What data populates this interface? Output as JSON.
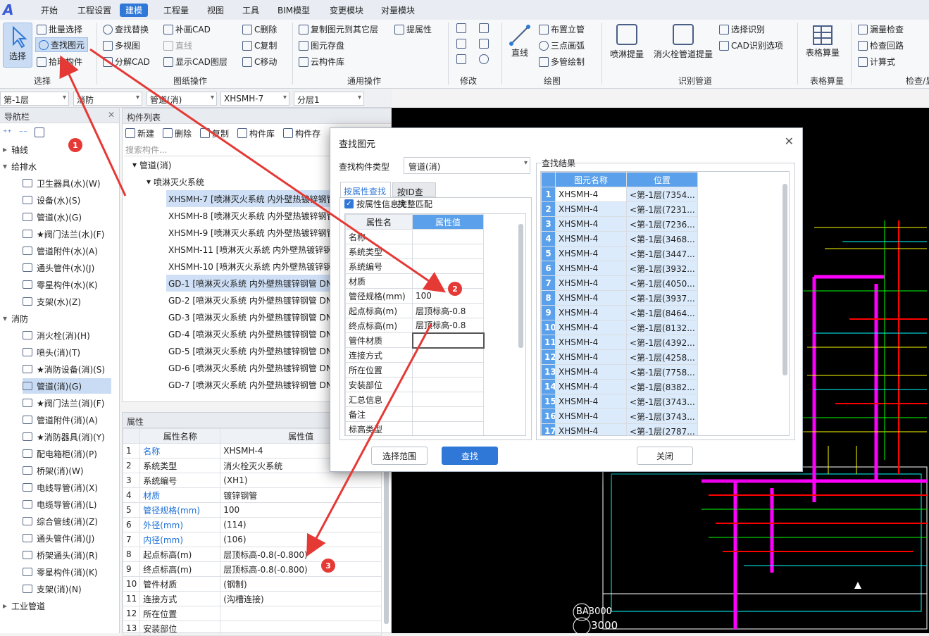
{
  "menubar": {
    "items": [
      "开始",
      "工程设置",
      "建模",
      "工程量",
      "视图",
      "工具",
      "BIM模型",
      "变更模块",
      "对量模块"
    ],
    "active_index": 2
  },
  "ribbon": {
    "select_big": "选择",
    "select_group": [
      "批量选择",
      "查找图元",
      "拾取构件"
    ],
    "group_select": "选择",
    "drawing_ops": [
      "查找替换",
      "补画CAD",
      "C删除",
      "多视图",
      "直线",
      "C复制",
      "分解CAD",
      "显示CAD图层",
      "C移动"
    ],
    "group_drawing": "图纸操作",
    "general_ops": [
      "复制图元到其它层",
      "提属性",
      "图元存盘",
      "云构件库"
    ],
    "group_general": "通用操作",
    "group_modify": "修改",
    "draw_line": "直线",
    "draw_ops": [
      "布置立管",
      "三点画弧",
      "多管绘制"
    ],
    "group_draw": "绘图",
    "identify_big": [
      "喷淋提量",
      "消火栓管道提量"
    ],
    "identify_ops": [
      "选择识别",
      "CAD识别选项"
    ],
    "group_identify": "识别管道",
    "table_big": "表格算量",
    "group_table": "表格算量",
    "check_ops": [
      "漏量检查",
      "检查回路",
      "计算式"
    ],
    "group_check": "检查/显"
  },
  "selectors": [
    "第-1层",
    "消防",
    "管道(消)",
    "XHSMH-7",
    "分层1"
  ],
  "nav": {
    "title": "导航栏",
    "items": [
      {
        "label": "轴线",
        "level": 0,
        "expand": "▸"
      },
      {
        "label": "给排水",
        "level": 0,
        "expand": "▾"
      },
      {
        "label": "卫生器具(水)(W)",
        "level": 1
      },
      {
        "label": "设备(水)(S)",
        "level": 1
      },
      {
        "label": "管道(水)(G)",
        "level": 1
      },
      {
        "label": "★阀门法兰(水)(F)",
        "level": 1
      },
      {
        "label": "管道附件(水)(A)",
        "level": 1
      },
      {
        "label": "通头管件(水)(J)",
        "level": 1
      },
      {
        "label": "零星构件(水)(K)",
        "level": 1
      },
      {
        "label": "支架(水)(Z)",
        "level": 1
      },
      {
        "label": "消防",
        "level": 0,
        "expand": "▾"
      },
      {
        "label": "消火栓(消)(H)",
        "level": 1
      },
      {
        "label": "喷头(消)(T)",
        "level": 1
      },
      {
        "label": "★消防设备(消)(S)",
        "level": 1
      },
      {
        "label": "管道(消)(G)",
        "level": 1,
        "selected": true
      },
      {
        "label": "★阀门法兰(消)(F)",
        "level": 1
      },
      {
        "label": "管道附件(消)(A)",
        "level": 1
      },
      {
        "label": "★消防器具(消)(Y)",
        "level": 1
      },
      {
        "label": "配电箱柜(消)(P)",
        "level": 1
      },
      {
        "label": "桥架(消)(W)",
        "level": 1
      },
      {
        "label": "电线导管(消)(X)",
        "level": 1
      },
      {
        "label": "电缆导管(消)(L)",
        "level": 1
      },
      {
        "label": "综合管线(消)(Z)",
        "level": 1
      },
      {
        "label": "通头管件(消)(J)",
        "level": 1
      },
      {
        "label": "桥架通头(消)(R)",
        "level": 1
      },
      {
        "label": "零星构件(消)(K)",
        "level": 1
      },
      {
        "label": "支架(消)(N)",
        "level": 1
      },
      {
        "label": "工业管道",
        "level": 0,
        "expand": "▸"
      }
    ]
  },
  "complist": {
    "title": "构件列表",
    "toolbar": [
      "新建",
      "删除",
      "复制",
      "构件库",
      "构件存"
    ],
    "search_placeholder": "搜索构件...",
    "tree_root": "管道(消)",
    "tree_sub": "喷淋灭火系统",
    "rows": [
      {
        "name": "XHSMH-7 [喷淋灭火系统 内外壁热镀锌钢管",
        "selected": true
      },
      {
        "name": "XHSMH-8 [喷淋灭火系统 内外壁热镀锌钢管"
      },
      {
        "name": "XHSMH-9 [喷淋灭火系统 内外壁热镀锌钢管"
      },
      {
        "name": "XHSMH-11 [喷淋灭火系统 内外壁热镀锌钢"
      },
      {
        "name": "XHSMH-10 [喷淋灭火系统 内外壁热镀锌钢"
      },
      {
        "name": "GD-1 [喷淋灭火系统 内外壁热镀锌钢管 DN",
        "selected": true
      },
      {
        "name": "GD-2 [喷淋灭火系统 内外壁热镀锌钢管 DN"
      },
      {
        "name": "GD-3 [喷淋灭火系统 内外壁热镀锌钢管 DN"
      },
      {
        "name": "GD-4 [喷淋灭火系统 内外壁热镀锌钢管 DN"
      },
      {
        "name": "GD-5 [喷淋灭火系统 内外壁热镀锌钢管 DN"
      },
      {
        "name": "GD-6 [喷淋灭火系统 内外壁热镀锌钢管 DN"
      },
      {
        "name": "GD-7 [喷淋灭火系统 内外壁热镀锌钢管 DN"
      }
    ]
  },
  "props": {
    "title": "属性",
    "header": [
      "属性名称",
      "属性值"
    ],
    "rows": [
      {
        "n": "1",
        "name": "名称",
        "value": "XHSMH-4",
        "blue": true
      },
      {
        "n": "2",
        "name": "系统类型",
        "value": "消火栓灭火系统"
      },
      {
        "n": "3",
        "name": "系统编号",
        "value": "(XH1)"
      },
      {
        "n": "4",
        "name": "材质",
        "value": "镀锌钢管",
        "blue": true
      },
      {
        "n": "5",
        "name": "管径规格(mm)",
        "value": "100",
        "blue": true
      },
      {
        "n": "6",
        "name": "外径(mm)",
        "value": "(114)",
        "blue": true
      },
      {
        "n": "7",
        "name": "内径(mm)",
        "value": "(106)",
        "blue": true
      },
      {
        "n": "8",
        "name": "起点标高(m)",
        "value": "层顶标高-0.8(-0.800)"
      },
      {
        "n": "9",
        "name": "终点标高(m)",
        "value": "层顶标高-0.8(-0.800)"
      },
      {
        "n": "10",
        "name": "管件材质",
        "value": "(钢制)"
      },
      {
        "n": "11",
        "name": "连接方式",
        "value": "(沟槽连接)"
      },
      {
        "n": "12",
        "name": "所在位置",
        "value": ""
      },
      {
        "n": "13",
        "name": "安装部位",
        "value": ""
      }
    ]
  },
  "dialog": {
    "title": "查找图元",
    "type_label": "查找构件类型",
    "type_value": "管道(消)",
    "tab_attr": "按属性查找",
    "tab_id": "按ID查找",
    "full_match": "按属性信息完整匹配",
    "attr_header": [
      "属性名",
      "属性值"
    ],
    "attr_rows": [
      {
        "name": "名称",
        "value": ""
      },
      {
        "name": "系统类型",
        "value": ""
      },
      {
        "name": "系统编号",
        "value": ""
      },
      {
        "name": "材质",
        "value": ""
      },
      {
        "name": "管径规格(mm)",
        "value": "100"
      },
      {
        "name": "起点标高(m)",
        "value": "层顶标高-0.8"
      },
      {
        "name": "终点标高(m)",
        "value": "层顶标高-0.8"
      },
      {
        "name": "管件材质",
        "value": ""
      },
      {
        "name": "连接方式",
        "value": ""
      },
      {
        "name": "所在位置",
        "value": ""
      },
      {
        "name": "安装部位",
        "value": ""
      },
      {
        "name": "汇总信息",
        "value": ""
      },
      {
        "name": "备注",
        "value": ""
      },
      {
        "name": "标高类型",
        "value": ""
      }
    ],
    "results_label": "查找结果",
    "results_header": [
      "图元名称",
      "位置"
    ],
    "results": [
      {
        "n": "1",
        "name": "XHSMH-4",
        "pos": "<第-1层(7354..."
      },
      {
        "n": "2",
        "name": "XHSMH-4",
        "pos": "<第-1层(7231..."
      },
      {
        "n": "3",
        "name": "XHSMH-4",
        "pos": "<第-1层(7236..."
      },
      {
        "n": "4",
        "name": "XHSMH-4",
        "pos": "<第-1层(3468..."
      },
      {
        "n": "5",
        "name": "XHSMH-4",
        "pos": "<第-1层(3447..."
      },
      {
        "n": "6",
        "name": "XHSMH-4",
        "pos": "<第-1层(3932..."
      },
      {
        "n": "7",
        "name": "XHSMH-4",
        "pos": "<第-1层(4050..."
      },
      {
        "n": "8",
        "name": "XHSMH-4",
        "pos": "<第-1层(3937..."
      },
      {
        "n": "9",
        "name": "XHSMH-4",
        "pos": "<第-1层(8464..."
      },
      {
        "n": "10",
        "name": "XHSMH-4",
        "pos": "<第-1层(8132..."
      },
      {
        "n": "11",
        "name": "XHSMH-4",
        "pos": "<第-1层(4392..."
      },
      {
        "n": "12",
        "name": "XHSMH-4",
        "pos": "<第-1层(4258..."
      },
      {
        "n": "13",
        "name": "XHSMH-4",
        "pos": "<第-1层(7758..."
      },
      {
        "n": "14",
        "name": "XHSMH-4",
        "pos": "<第-1层(8382..."
      },
      {
        "n": "15",
        "name": "XHSMH-4",
        "pos": "<第-1层(3743..."
      },
      {
        "n": "16",
        "name": "XHSMH-4",
        "pos": "<第-1层(3743..."
      },
      {
        "n": "17",
        "name": "XHSMH-4",
        "pos": "<第-1层(2787..."
      }
    ],
    "btn_range": "选择范围",
    "btn_find": "查找",
    "btn_close": "关闭"
  },
  "annotations": [
    "1",
    "2",
    "3"
  ],
  "cad": {
    "axis_text": "BA3000",
    "dim_text": "3000"
  },
  "colors": {
    "accent": "#2f78d8",
    "arrow": "#e53935",
    "cad_bg": "#000000",
    "pipe": "#ff00ff"
  }
}
